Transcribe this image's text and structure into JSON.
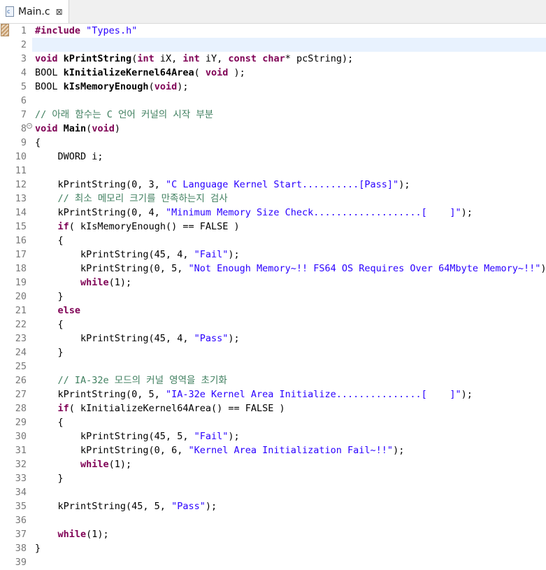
{
  "tab": {
    "title": "Main.c",
    "icon_letter": "c",
    "close": "⊠"
  },
  "editor": {
    "highlighted_line": 2,
    "fold_line": 8,
    "lines": [
      [
        [
          "pp",
          "#include"
        ],
        [
          "n",
          " "
        ],
        [
          "str",
          "\"Types.h\""
        ]
      ],
      [],
      [
        [
          "kw",
          "void"
        ],
        [
          "n",
          " "
        ],
        [
          "fn",
          "kPrintString"
        ],
        [
          "n",
          "("
        ],
        [
          "kw",
          "int"
        ],
        [
          "n",
          " iX, "
        ],
        [
          "kw",
          "int"
        ],
        [
          "n",
          " iY, "
        ],
        [
          "kw",
          "const"
        ],
        [
          "n",
          " "
        ],
        [
          "kw",
          "char"
        ],
        [
          "n",
          "* pcString);"
        ]
      ],
      [
        [
          "n",
          "BOOL "
        ],
        [
          "fn",
          "kInitializeKernel64Area"
        ],
        [
          "n",
          "( "
        ],
        [
          "kw",
          "void"
        ],
        [
          "n",
          " );"
        ]
      ],
      [
        [
          "n",
          "BOOL "
        ],
        [
          "fn",
          "kIsMemoryEnough"
        ],
        [
          "n",
          "("
        ],
        [
          "kw",
          "void"
        ],
        [
          "n",
          ");"
        ]
      ],
      [],
      [
        [
          "cm",
          "// 아래 함수는 C 언어 커널의 시작 부분"
        ]
      ],
      [
        [
          "kw",
          "void"
        ],
        [
          "n",
          " "
        ],
        [
          "fn",
          "Main"
        ],
        [
          "n",
          "("
        ],
        [
          "kw",
          "void"
        ],
        [
          "n",
          ")"
        ]
      ],
      [
        [
          "n",
          "{"
        ]
      ],
      [
        [
          "n",
          "    DWORD i;"
        ]
      ],
      [],
      [
        [
          "n",
          "    kPrintString(0, 3, "
        ],
        [
          "str",
          "\"C Language Kernel Start..........[Pass]\""
        ],
        [
          "n",
          ");"
        ]
      ],
      [
        [
          "n",
          "    "
        ],
        [
          "cm",
          "// 최소 메모리 크기를 만족하는지 검사"
        ]
      ],
      [
        [
          "n",
          "    kPrintString(0, 4, "
        ],
        [
          "str",
          "\"Minimum Memory Size Check...................[    ]\""
        ],
        [
          "n",
          ");"
        ]
      ],
      [
        [
          "n",
          "    "
        ],
        [
          "kw",
          "if"
        ],
        [
          "n",
          "( kIsMemoryEnough() == FALSE )"
        ]
      ],
      [
        [
          "n",
          "    {"
        ]
      ],
      [
        [
          "n",
          "        kPrintString(45, 4, "
        ],
        [
          "str",
          "\"Fail\""
        ],
        [
          "n",
          ");"
        ]
      ],
      [
        [
          "n",
          "        kPrintString(0, 5, "
        ],
        [
          "str",
          "\"Not Enough Memory~!! FS64 OS Requires Over 64Mbyte Memory~!!\""
        ],
        [
          "n",
          ");"
        ]
      ],
      [
        [
          "n",
          "        "
        ],
        [
          "kw",
          "while"
        ],
        [
          "n",
          "(1);"
        ]
      ],
      [
        [
          "n",
          "    }"
        ]
      ],
      [
        [
          "n",
          "    "
        ],
        [
          "kw",
          "else"
        ]
      ],
      [
        [
          "n",
          "    {"
        ]
      ],
      [
        [
          "n",
          "        kPrintString(45, 4, "
        ],
        [
          "str",
          "\"Pass\""
        ],
        [
          "n",
          ");"
        ]
      ],
      [
        [
          "n",
          "    }"
        ]
      ],
      [],
      [
        [
          "n",
          "    "
        ],
        [
          "cm",
          "// IA-32e 모드의 커널 영역을 초기화"
        ]
      ],
      [
        [
          "n",
          "    kPrintString(0, 5, "
        ],
        [
          "str",
          "\"IA-32e Kernel Area Initialize...............[    ]\""
        ],
        [
          "n",
          ");"
        ]
      ],
      [
        [
          "n",
          "    "
        ],
        [
          "kw",
          "if"
        ],
        [
          "n",
          "( kInitializeKernel64Area() == FALSE )"
        ]
      ],
      [
        [
          "n",
          "    {"
        ]
      ],
      [
        [
          "n",
          "        kPrintString(45, 5, "
        ],
        [
          "str",
          "\"Fail\""
        ],
        [
          "n",
          ");"
        ]
      ],
      [
        [
          "n",
          "        kPrintString(0, 6, "
        ],
        [
          "str",
          "\"Kernel Area Initialization Fail~!!\""
        ],
        [
          "n",
          ");"
        ]
      ],
      [
        [
          "n",
          "        "
        ],
        [
          "kw",
          "while"
        ],
        [
          "n",
          "(1);"
        ]
      ],
      [
        [
          "n",
          "    }"
        ]
      ],
      [],
      [
        [
          "n",
          "    kPrintString(45, 5, "
        ],
        [
          "str",
          "\"Pass\""
        ],
        [
          "n",
          ");"
        ]
      ],
      [],
      [
        [
          "n",
          "    "
        ],
        [
          "kw",
          "while"
        ],
        [
          "n",
          "(1);"
        ]
      ],
      [
        [
          "n",
          "}"
        ]
      ],
      []
    ]
  }
}
